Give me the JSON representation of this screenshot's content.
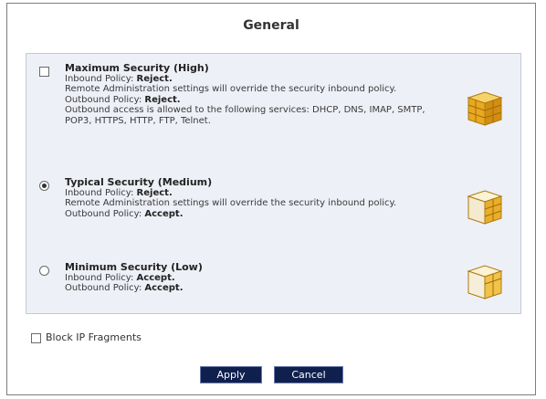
{
  "dialog": {
    "title": "General"
  },
  "options": [
    {
      "title": "Maximum Security (High)",
      "selected": false,
      "lines": [
        {
          "prefix": "Inbound Policy: ",
          "value": "Reject."
        },
        {
          "prefix": "Remote Administration settings will override the security inbound policy.",
          "value": ""
        },
        {
          "prefix": "Outbound Policy: ",
          "value": "Reject."
        },
        {
          "prefix": "Outbound access is allowed to the following services: DHCP, DNS, IMAP, SMTP, POP3, HTTPS, HTTP, FTP, Telnet.",
          "value": ""
        }
      ]
    },
    {
      "title": "Typical Security (Medium)",
      "selected": true,
      "lines": [
        {
          "prefix": "Inbound Policy: ",
          "value": "Reject."
        },
        {
          "prefix": "Remote Administration settings will override the security inbound policy.",
          "value": ""
        },
        {
          "prefix": "Outbound Policy: ",
          "value": "Accept."
        }
      ]
    },
    {
      "title": "Minimum Security (Low)",
      "selected": false,
      "lines": [
        {
          "prefix": "Inbound Policy: ",
          "value": "Accept."
        },
        {
          "prefix": "Outbound Policy: ",
          "value": "Accept."
        }
      ]
    }
  ],
  "block_ip_fragments": {
    "label": "Block IP Fragments",
    "checked": false
  },
  "buttons": {
    "apply": "Apply",
    "cancel": "Cancel"
  },
  "colors": {
    "button_bg": "#10204e",
    "panel_bg": "#eef0f7",
    "icon_gold": "#e8b02a"
  },
  "icons": {
    "security_level": "firewall-wall-icon"
  }
}
